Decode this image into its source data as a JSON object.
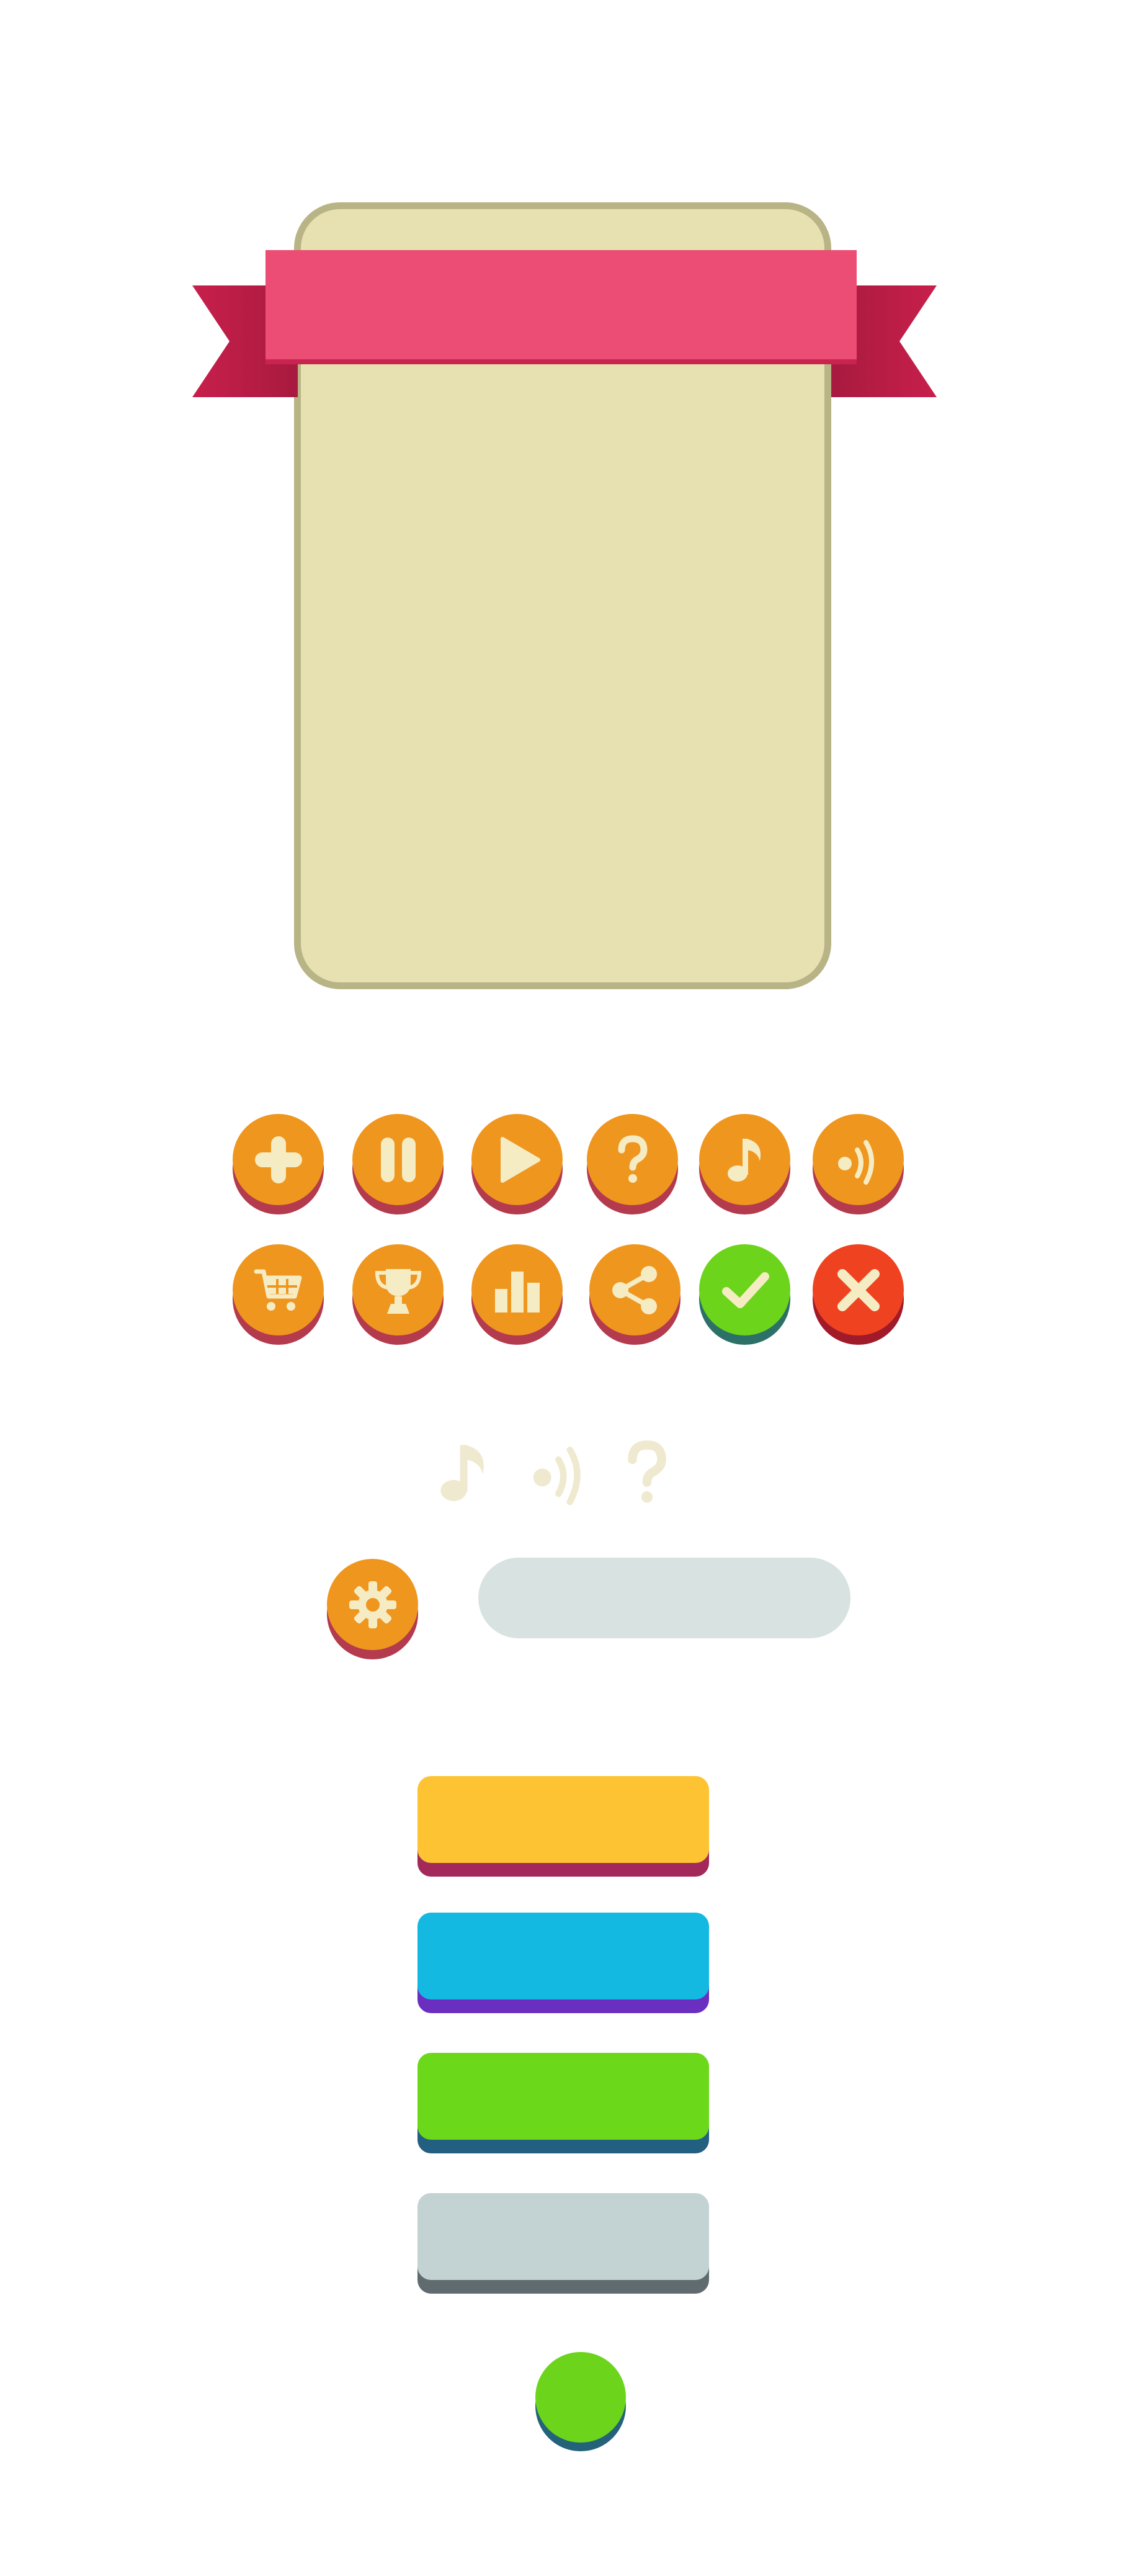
{
  "colors": {
    "panel_fill": "#e7e1b2",
    "panel_border": "#b8b486",
    "ribbon": "#ec4d74",
    "ribbon_dark": "#b81e45",
    "orange": "#ef961f",
    "icon_cream": "#f5ecc4",
    "button_base": "#b43a4d",
    "green": "#6cd41b",
    "green_base": "#2c7068",
    "red": "#ef4220",
    "red_base": "#a01a2a",
    "yellow": "#fdc332",
    "yellow_base": "#a3295b",
    "blue": "#14b9e2",
    "blue_base": "#6a2ec0",
    "lime": "#6cd81a",
    "lime_base": "#225f80",
    "gray": "#c3d3d3",
    "gray_base": "#5f6b6e",
    "faint": "#efe9d0"
  },
  "icons": {
    "row1": [
      "plus-icon",
      "pause-icon",
      "play-icon",
      "question-icon",
      "music-note-icon",
      "sound-icon"
    ],
    "row2": [
      "cart-icon",
      "trophy-icon",
      "leaderboard-icon",
      "share-icon",
      "check-icon",
      "close-icon"
    ],
    "faint": [
      "music-note-icon",
      "sound-icon",
      "question-icon"
    ],
    "settings": "gear-icon"
  }
}
